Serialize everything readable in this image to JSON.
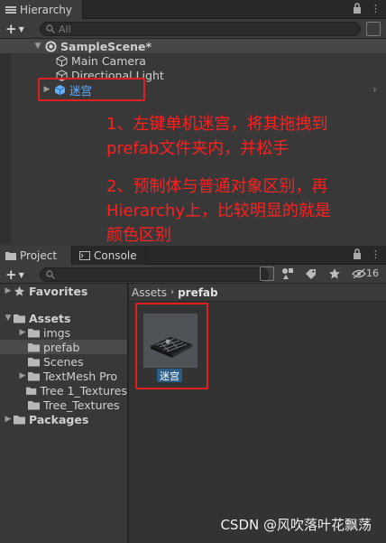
{
  "hierarchy": {
    "tab_label": "Hierarchy",
    "search_placeholder": "All",
    "scene": "SampleScene*",
    "items": [
      "Main Camera",
      "Directional Light"
    ],
    "prefab_item": "迷宫"
  },
  "annotation": {
    "line1": "1、左键单机迷宫，将其拖拽到",
    "line2": "prefab文件夹内，并松手",
    "line3": "2、预制体与普通对象区别，再",
    "line4": "Hierarchy上，比较明显的就是",
    "line5": "颜色区别"
  },
  "project": {
    "tabs": [
      "Project",
      "Console"
    ],
    "visible_count": "16",
    "tree": {
      "favorites": "Favorites",
      "assets": "Assets",
      "assets_children": [
        "imgs",
        "prefab",
        "Scenes",
        "TextMesh Pro",
        "Tree 1_Textures",
        "Tree_Textures"
      ],
      "packages": "Packages"
    },
    "breadcrumb": [
      "Assets",
      "prefab"
    ],
    "asset_name": "迷宫"
  },
  "watermark": "CSDN @风吹落叶花飘荡",
  "colors": {
    "annotation_red": "#ff2020",
    "prefab_blue": "#5fb0ff",
    "selection_blue": "#2c5d87"
  }
}
